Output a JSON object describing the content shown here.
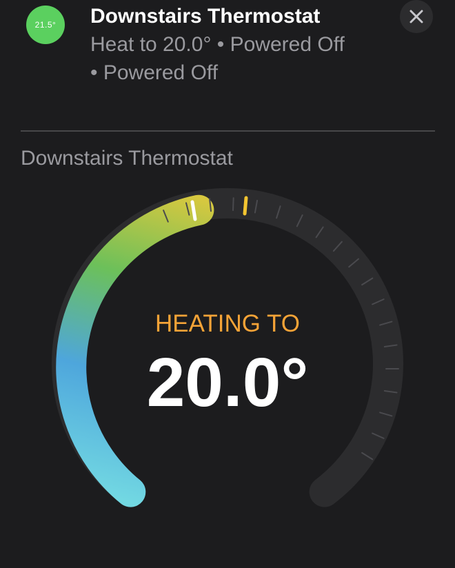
{
  "header": {
    "current_temp": "21.5°",
    "title": "Downstairs Thermostat",
    "status_line1": "Heat to 20.0° • Powered Off",
    "status_line2": "• Powered Off",
    "close_icon": "close-icon"
  },
  "section": {
    "title": "Downstairs Thermostat"
  },
  "dial": {
    "mode": "HEATING TO",
    "target": "20.0°",
    "target_value": 20.0,
    "current_value": 21.5,
    "colors": {
      "gradient_start": "#6fd6e0",
      "gradient_mid": "#4ea4da",
      "gradient_green": "#6cc05a",
      "gradient_end": "#d6c93e",
      "track": "#2c2c2e",
      "current_marker": "#f3c531",
      "target_marker": "#ffffff",
      "mode_text": "#f5a337"
    }
  }
}
